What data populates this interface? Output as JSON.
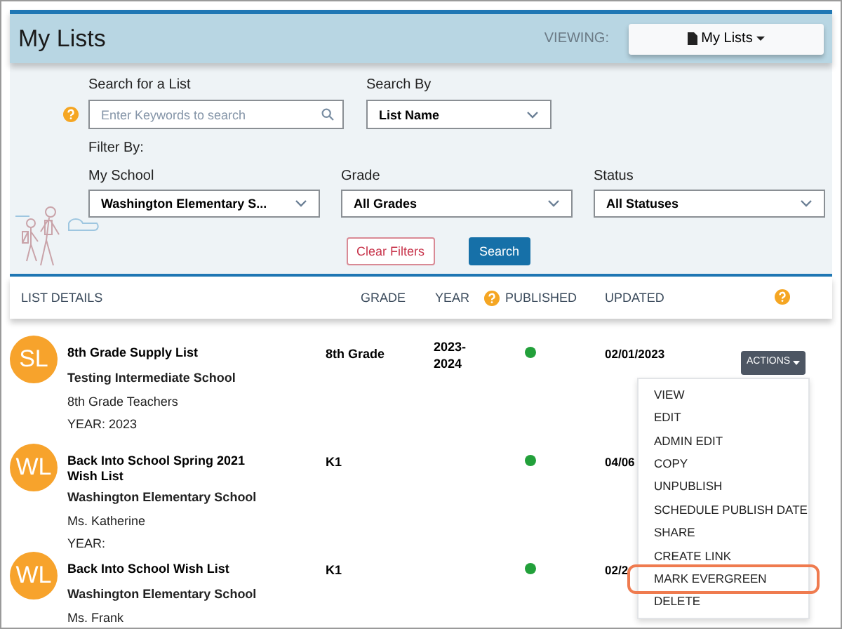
{
  "header": {
    "title": "My Lists",
    "viewing_label": "VIEWING:",
    "viewing_button": "My Lists"
  },
  "filters": {
    "search_label": "Search for a List",
    "search_placeholder": "Enter Keywords to search",
    "search_by_label": "Search By",
    "search_by_value": "List Name",
    "filter_by_label": "Filter By:",
    "selects": [
      {
        "label": "My School",
        "value": "Washington Elementary S..."
      },
      {
        "label": "Grade",
        "value": "All Grades"
      },
      {
        "label": "Status",
        "value": "All Statuses"
      }
    ],
    "clear_button": "Clear Filters",
    "search_button": "Search"
  },
  "table": {
    "columns": [
      "LIST DETAILS",
      "GRADE",
      "YEAR",
      "PUBLISHED",
      "UPDATED"
    ],
    "rows": [
      {
        "initials": "SL",
        "name": "8th Grade Supply List",
        "school": "Testing Intermediate School",
        "teacher": "8th Grade Teachers",
        "year_line": "YEAR: 2023",
        "grade": "8th Grade",
        "year": "2023-\n2024",
        "published": true,
        "updated": "02/01/2023"
      },
      {
        "initials": "WL",
        "name": "Back Into School Spring 2021 Wish List",
        "school": "Washington Elementary School",
        "teacher": "Ms. Katherine",
        "year_line": "YEAR:",
        "grade": "K1",
        "year": "",
        "published": true,
        "updated": "04/06"
      },
      {
        "initials": "WL",
        "name": "Back Into School Wish List",
        "school": "Washington Elementary School",
        "teacher": "Ms. Frank",
        "year_line": "",
        "grade": "K1",
        "year": "",
        "published": true,
        "updated": "02/2"
      }
    ]
  },
  "actions": {
    "button": "ACTIONS",
    "menu": [
      {
        "label": "VIEW",
        "highlighted": false
      },
      {
        "label": "EDIT",
        "highlighted": false
      },
      {
        "label": "ADMIN EDIT",
        "highlighted": false
      },
      {
        "label": "COPY",
        "highlighted": false
      },
      {
        "label": "UNPUBLISH",
        "highlighted": false
      },
      {
        "label": "SCHEDULE PUBLISH DATE",
        "highlighted": false
      },
      {
        "label": "SHARE",
        "highlighted": false
      },
      {
        "label": "CREATE LINK",
        "highlighted": false
      },
      {
        "label": "MARK EVERGREEN",
        "highlighted": true
      },
      {
        "label": "DELETE",
        "highlighted": false
      }
    ]
  }
}
